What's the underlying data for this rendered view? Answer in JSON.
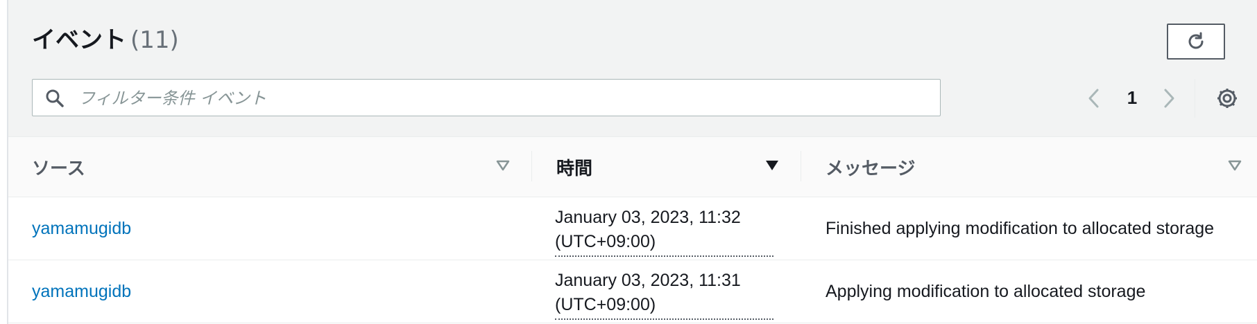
{
  "header": {
    "title": "イベント",
    "count": "(11)"
  },
  "search": {
    "placeholder": "フィルター条件 イベント",
    "value": ""
  },
  "pagination": {
    "current_page": "1"
  },
  "icons": {
    "refresh": "refresh-icon",
    "search": "search-icon",
    "prev": "chevron-left-icon",
    "next": "chevron-right-icon",
    "settings": "gear-icon",
    "sort": "caret-down-icon"
  },
  "colors": {
    "link": "#0073bb",
    "header_bg": "#f2f3f3",
    "text": "#16191f",
    "muted": "#687078"
  },
  "table": {
    "columns": [
      {
        "label": "ソース",
        "sorted": false
      },
      {
        "label": "時間",
        "sorted": true
      },
      {
        "label": "メッセージ",
        "sorted": false
      }
    ],
    "rows": [
      {
        "source": "yamamugidb",
        "time_line1": "January 03, 2023, 11:32",
        "time_line2": "(UTC+09:00)",
        "message": "Finished applying modification to allocated storage"
      },
      {
        "source": "yamamugidb",
        "time_line1": "January 03, 2023, 11:31",
        "time_line2": "(UTC+09:00)",
        "message": "Applying modification to allocated storage"
      }
    ]
  }
}
